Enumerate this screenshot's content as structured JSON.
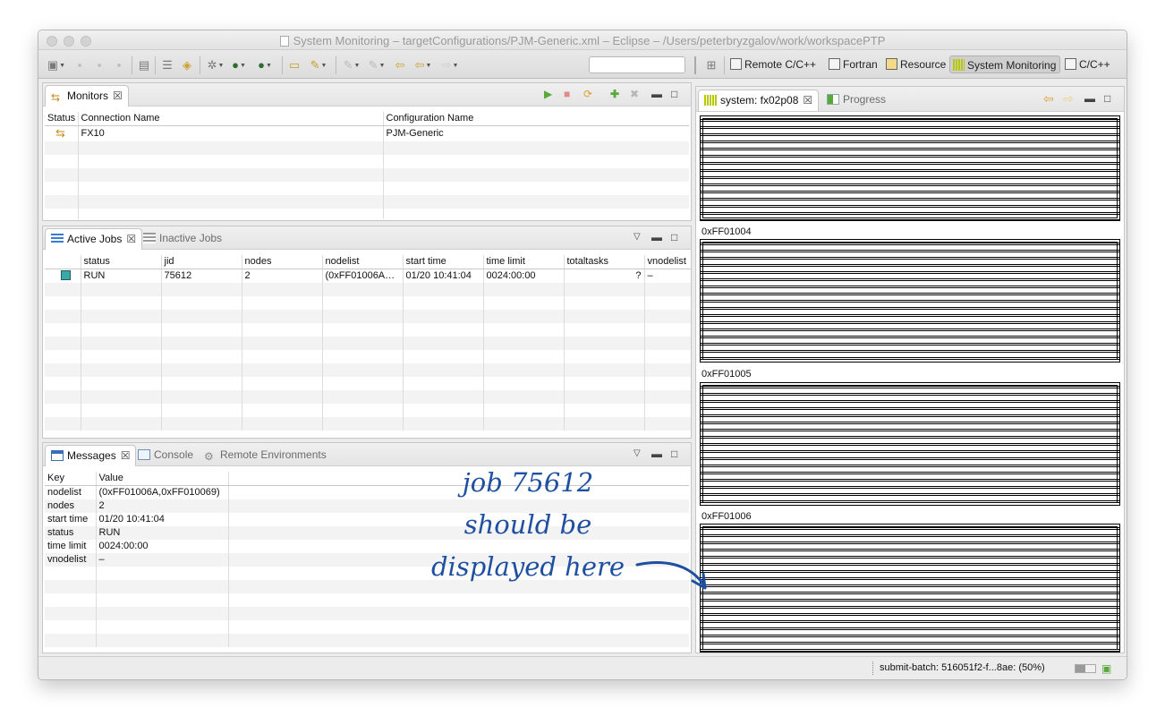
{
  "window": {
    "title": "System Monitoring – targetConfigurations/PJM-Generic.xml – Eclipse – /Users/peterbryzgalov/work/workspacePTP"
  },
  "toolbar": {
    "quick_access_placeholder": "",
    "perspectives": [
      {
        "label": "Remote C/C++",
        "icon": "remote-cpp-icon"
      },
      {
        "label": "Fortran",
        "icon": "fortran-icon"
      },
      {
        "label": "Resource",
        "icon": "resource-icon"
      },
      {
        "label": "System Monitoring",
        "icon": "system-monitoring-icon",
        "active": true
      },
      {
        "label": "C/C++",
        "icon": "cpp-icon"
      }
    ]
  },
  "monitors": {
    "tab_label": "Monitors",
    "columns": [
      "Status",
      "Connection Name",
      "Configuration Name"
    ],
    "rows": [
      {
        "status_icon": "monitor-running-icon",
        "connection": "FX10",
        "configuration": "PJM-Generic"
      }
    ]
  },
  "jobs": {
    "tabs": [
      "Active Jobs",
      "Inactive Jobs"
    ],
    "columns": [
      "status",
      "jid",
      "nodes",
      "nodelist",
      "start time",
      "time limit",
      "totaltasks",
      "vnodelist"
    ],
    "rows": [
      {
        "status_color": "#3aa8a8",
        "status": "RUN",
        "jid": "75612",
        "nodes": "2",
        "nodelist": "(0xFF01006A…",
        "start_time": "01/20 10:41:04",
        "time_limit": "0024:00:00",
        "totaltasks": "?",
        "vnodelist": "–"
      }
    ]
  },
  "messages": {
    "tabs": [
      "Messages",
      "Console",
      "Remote Environments"
    ],
    "columns": [
      "Key",
      "Value"
    ],
    "rows": [
      {
        "key": "nodelist",
        "value": "(0xFF01006A,0xFF010069)"
      },
      {
        "key": "nodes",
        "value": "2"
      },
      {
        "key": "start time",
        "value": "01/20 10:41:04"
      },
      {
        "key": "status",
        "value": "RUN"
      },
      {
        "key": "time limit",
        "value": "0024:00:00"
      },
      {
        "key": "vnodelist",
        "value": "–"
      }
    ]
  },
  "system_view": {
    "tabs": [
      "system: fx02p08",
      "Progress"
    ],
    "node_labels": [
      "0xFF01004",
      "0xFF01005",
      "0xFF01006"
    ]
  },
  "annotation": {
    "lines": [
      "job 75612",
      "should be",
      "displayed here"
    ],
    "color": "#1f4fa0"
  },
  "statusbar": {
    "text": "submit-batch: 516051f2-f...8ae: (50%)",
    "progress": 0.5
  }
}
